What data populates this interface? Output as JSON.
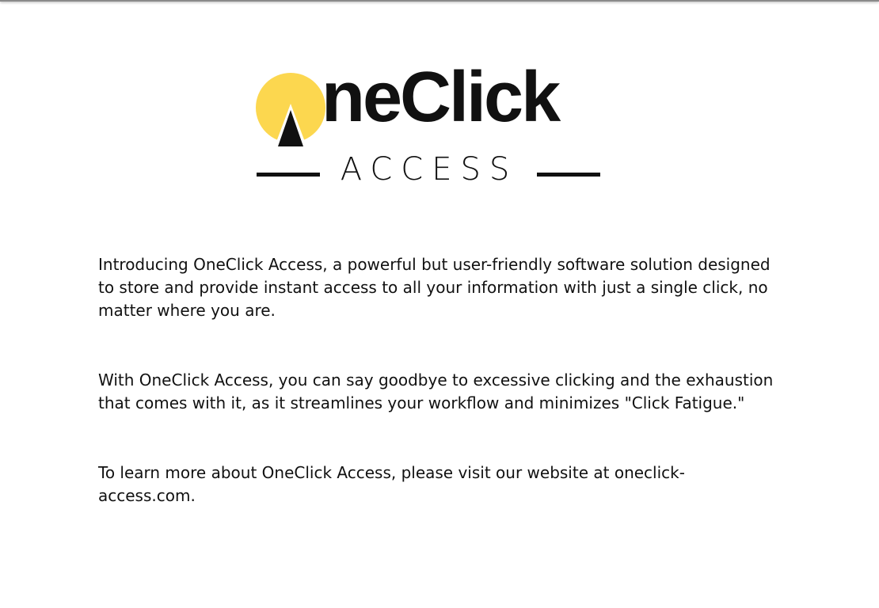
{
  "logo": {
    "wordmark": "neClick",
    "subtitle": "ACCESS",
    "icon": "letter-o-arrow-icon",
    "colors": {
      "accent_yellow": "#FCD74F",
      "dark": "#111111"
    }
  },
  "content": {
    "paragraphs": [
      "Introducing OneClick Access, a powerful but user-friendly software solution designed to store and provide instant access to all your information with just a single click, no matter where you are.",
      "With OneClick Access, you can say goodbye to excessive clicking and the exhaustion that comes with it, as it streamlines your workflow and minimizes \"Click Fatigue.\"",
      "To learn more about OneClick Access, please visit our website at oneclick-access.com."
    ]
  }
}
